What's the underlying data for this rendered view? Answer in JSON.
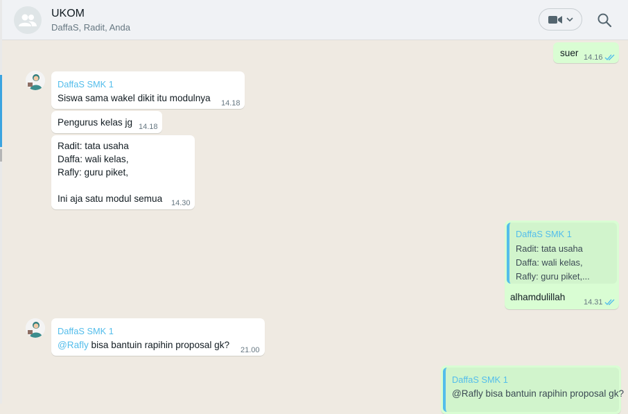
{
  "header": {
    "title": "UKOM",
    "subtitle": "DaffaS, Radit, Anda"
  },
  "icons": {
    "group_avatar": "group-icon",
    "video": "video-camera-icon",
    "dropdown": "chevron-down-icon",
    "search": "search-icon",
    "read": "double-check-icon"
  },
  "colors": {
    "incoming_bubble": "#ffffff",
    "outgoing_bubble": "#d9fdd3",
    "sender_name": "#53bdeb",
    "chat_background": "#efeae2",
    "read_ticks": "#53bdeb"
  },
  "messages": {
    "m1": {
      "text": "suer",
      "time": "14.16"
    },
    "m2": {
      "sender": "DaffaS SMK 1",
      "text": "Siswa sama wakel dikit itu modulnya",
      "time": "14.18"
    },
    "m3": {
      "text": "Pengurus kelas jg",
      "time": "14.18"
    },
    "m4": {
      "line1": "Radit: tata usaha",
      "line2": "Daffa: wali kelas,",
      "line3": "Rafly: guru piket,",
      "line4": "Ini aja satu modul semua",
      "time": "14.30"
    },
    "m5": {
      "quote_sender": "DaffaS SMK 1",
      "quote_line1": "Radit: tata usaha",
      "quote_line2": "Daffa: wali kelas,",
      "quote_line3": "Rafly: guru piket,...",
      "text": "alhamdulillah",
      "time": "14.31"
    },
    "m6": {
      "sender": "DaffaS SMK 1",
      "mention": "@Rafly",
      "text": " bisa bantuin rapihin proposal gk?",
      "time": "21.00"
    },
    "m7": {
      "quote_sender": "DaffaS SMK 1",
      "quote_text": "@Rafly bisa bantuin rapihin proposal gk?"
    }
  }
}
